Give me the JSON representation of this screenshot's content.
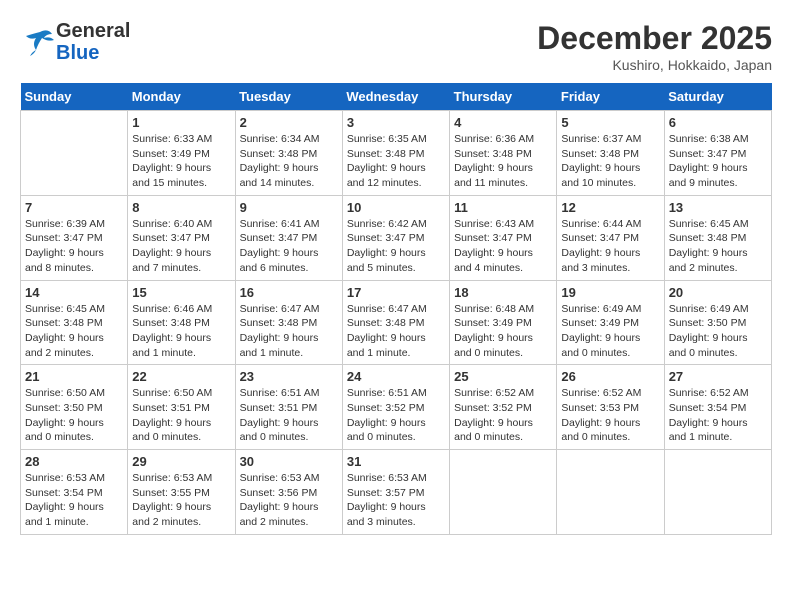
{
  "header": {
    "logo_general": "General",
    "logo_blue": "Blue",
    "month": "December 2025",
    "location": "Kushiro, Hokkaido, Japan"
  },
  "days_of_week": [
    "Sunday",
    "Monday",
    "Tuesday",
    "Wednesday",
    "Thursday",
    "Friday",
    "Saturday"
  ],
  "weeks": [
    [
      {
        "day": "",
        "info": ""
      },
      {
        "day": "1",
        "info": "Sunrise: 6:33 AM\nSunset: 3:49 PM\nDaylight: 9 hours\nand 15 minutes."
      },
      {
        "day": "2",
        "info": "Sunrise: 6:34 AM\nSunset: 3:48 PM\nDaylight: 9 hours\nand 14 minutes."
      },
      {
        "day": "3",
        "info": "Sunrise: 6:35 AM\nSunset: 3:48 PM\nDaylight: 9 hours\nand 12 minutes."
      },
      {
        "day": "4",
        "info": "Sunrise: 6:36 AM\nSunset: 3:48 PM\nDaylight: 9 hours\nand 11 minutes."
      },
      {
        "day": "5",
        "info": "Sunrise: 6:37 AM\nSunset: 3:48 PM\nDaylight: 9 hours\nand 10 minutes."
      },
      {
        "day": "6",
        "info": "Sunrise: 6:38 AM\nSunset: 3:47 PM\nDaylight: 9 hours\nand 9 minutes."
      }
    ],
    [
      {
        "day": "7",
        "info": "Sunrise: 6:39 AM\nSunset: 3:47 PM\nDaylight: 9 hours\nand 8 minutes."
      },
      {
        "day": "8",
        "info": "Sunrise: 6:40 AM\nSunset: 3:47 PM\nDaylight: 9 hours\nand 7 minutes."
      },
      {
        "day": "9",
        "info": "Sunrise: 6:41 AM\nSunset: 3:47 PM\nDaylight: 9 hours\nand 6 minutes."
      },
      {
        "day": "10",
        "info": "Sunrise: 6:42 AM\nSunset: 3:47 PM\nDaylight: 9 hours\nand 5 minutes."
      },
      {
        "day": "11",
        "info": "Sunrise: 6:43 AM\nSunset: 3:47 PM\nDaylight: 9 hours\nand 4 minutes."
      },
      {
        "day": "12",
        "info": "Sunrise: 6:44 AM\nSunset: 3:47 PM\nDaylight: 9 hours\nand 3 minutes."
      },
      {
        "day": "13",
        "info": "Sunrise: 6:45 AM\nSunset: 3:48 PM\nDaylight: 9 hours\nand 2 minutes."
      }
    ],
    [
      {
        "day": "14",
        "info": "Sunrise: 6:45 AM\nSunset: 3:48 PM\nDaylight: 9 hours\nand 2 minutes."
      },
      {
        "day": "15",
        "info": "Sunrise: 6:46 AM\nSunset: 3:48 PM\nDaylight: 9 hours\nand 1 minute."
      },
      {
        "day": "16",
        "info": "Sunrise: 6:47 AM\nSunset: 3:48 PM\nDaylight: 9 hours\nand 1 minute."
      },
      {
        "day": "17",
        "info": "Sunrise: 6:47 AM\nSunset: 3:48 PM\nDaylight: 9 hours\nand 1 minute."
      },
      {
        "day": "18",
        "info": "Sunrise: 6:48 AM\nSunset: 3:49 PM\nDaylight: 9 hours\nand 0 minutes."
      },
      {
        "day": "19",
        "info": "Sunrise: 6:49 AM\nSunset: 3:49 PM\nDaylight: 9 hours\nand 0 minutes."
      },
      {
        "day": "20",
        "info": "Sunrise: 6:49 AM\nSunset: 3:50 PM\nDaylight: 9 hours\nand 0 minutes."
      }
    ],
    [
      {
        "day": "21",
        "info": "Sunrise: 6:50 AM\nSunset: 3:50 PM\nDaylight: 9 hours\nand 0 minutes."
      },
      {
        "day": "22",
        "info": "Sunrise: 6:50 AM\nSunset: 3:51 PM\nDaylight: 9 hours\nand 0 minutes."
      },
      {
        "day": "23",
        "info": "Sunrise: 6:51 AM\nSunset: 3:51 PM\nDaylight: 9 hours\nand 0 minutes."
      },
      {
        "day": "24",
        "info": "Sunrise: 6:51 AM\nSunset: 3:52 PM\nDaylight: 9 hours\nand 0 minutes."
      },
      {
        "day": "25",
        "info": "Sunrise: 6:52 AM\nSunset: 3:52 PM\nDaylight: 9 hours\nand 0 minutes."
      },
      {
        "day": "26",
        "info": "Sunrise: 6:52 AM\nSunset: 3:53 PM\nDaylight: 9 hours\nand 0 minutes."
      },
      {
        "day": "27",
        "info": "Sunrise: 6:52 AM\nSunset: 3:54 PM\nDaylight: 9 hours\nand 1 minute."
      }
    ],
    [
      {
        "day": "28",
        "info": "Sunrise: 6:53 AM\nSunset: 3:54 PM\nDaylight: 9 hours\nand 1 minute."
      },
      {
        "day": "29",
        "info": "Sunrise: 6:53 AM\nSunset: 3:55 PM\nDaylight: 9 hours\nand 2 minutes."
      },
      {
        "day": "30",
        "info": "Sunrise: 6:53 AM\nSunset: 3:56 PM\nDaylight: 9 hours\nand 2 minutes."
      },
      {
        "day": "31",
        "info": "Sunrise: 6:53 AM\nSunset: 3:57 PM\nDaylight: 9 hours\nand 3 minutes."
      },
      {
        "day": "",
        "info": ""
      },
      {
        "day": "",
        "info": ""
      },
      {
        "day": "",
        "info": ""
      }
    ]
  ]
}
